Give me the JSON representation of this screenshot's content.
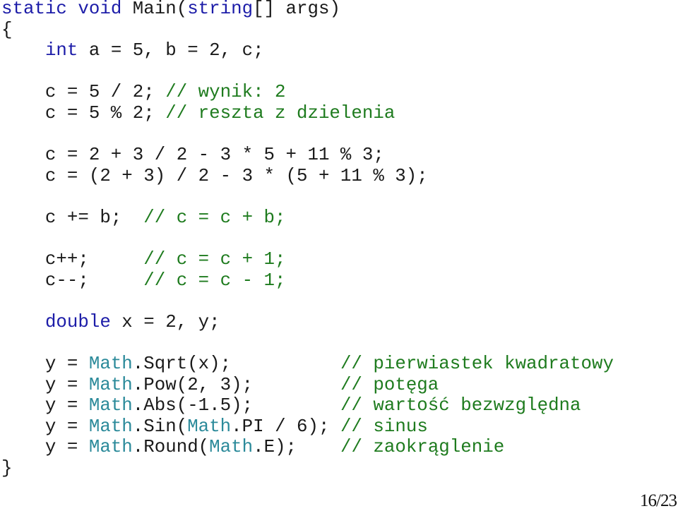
{
  "slide": {
    "page_indicator": "16/23",
    "colors": {
      "keyword": "#1c1ca8",
      "class": "#2b8a9a",
      "comment": "#1e7b1e",
      "text": "#1a1a1a"
    },
    "lines": [
      [
        [
          "kw",
          "static"
        ],
        [
          "t",
          " "
        ],
        [
          "kw",
          "void"
        ],
        [
          "t",
          " Main("
        ],
        [
          "kw",
          "string"
        ],
        [
          "t",
          "[] args)"
        ]
      ],
      [
        [
          "t",
          "{"
        ]
      ],
      [
        [
          "t",
          "    "
        ],
        [
          "kw",
          "int"
        ],
        [
          "t",
          " a = 5, b = 2, c;"
        ]
      ],
      [
        [
          "t",
          ""
        ]
      ],
      [
        [
          "t",
          "    c = 5 / 2; "
        ],
        [
          "cm",
          "// wynik: 2"
        ]
      ],
      [
        [
          "t",
          "    c = 5 % 2; "
        ],
        [
          "cm",
          "// reszta z dzielenia"
        ]
      ],
      [
        [
          "t",
          ""
        ]
      ],
      [
        [
          "t",
          "    c = 2 + 3 / 2 - 3 * 5 + 11 % 3;"
        ]
      ],
      [
        [
          "t",
          "    c = (2 + 3) / 2 - 3 * (5 + 11 % 3);"
        ]
      ],
      [
        [
          "t",
          ""
        ]
      ],
      [
        [
          "t",
          "    c += b;  "
        ],
        [
          "cm",
          "// c = c + b;"
        ]
      ],
      [
        [
          "t",
          ""
        ]
      ],
      [
        [
          "t",
          "    c++;     "
        ],
        [
          "cm",
          "// c = c + 1;"
        ]
      ],
      [
        [
          "t",
          "    c--;     "
        ],
        [
          "cm",
          "// c = c - 1;"
        ]
      ],
      [
        [
          "t",
          ""
        ]
      ],
      [
        [
          "t",
          "    "
        ],
        [
          "kw",
          "double"
        ],
        [
          "t",
          " x = 2, y;"
        ]
      ],
      [
        [
          "t",
          ""
        ]
      ],
      [
        [
          "t",
          "    y = "
        ],
        [
          "cls",
          "Math"
        ],
        [
          "t",
          ".Sqrt(x);          "
        ],
        [
          "cm",
          "// pierwiastek kwadratowy"
        ]
      ],
      [
        [
          "t",
          "    y = "
        ],
        [
          "cls",
          "Math"
        ],
        [
          "t",
          ".Pow(2, 3);        "
        ],
        [
          "cm",
          "// potęga"
        ]
      ],
      [
        [
          "t",
          "    y = "
        ],
        [
          "cls",
          "Math"
        ],
        [
          "t",
          ".Abs(-1.5);        "
        ],
        [
          "cm",
          "// wartość bezwzględna"
        ]
      ],
      [
        [
          "t",
          "    y = "
        ],
        [
          "cls",
          "Math"
        ],
        [
          "t",
          ".Sin("
        ],
        [
          "cls",
          "Math"
        ],
        [
          "t",
          ".PI / 6); "
        ],
        [
          "cm",
          "// sinus"
        ]
      ],
      [
        [
          "t",
          "    y = "
        ],
        [
          "cls",
          "Math"
        ],
        [
          "t",
          ".Round("
        ],
        [
          "cls",
          "Math"
        ],
        [
          "t",
          ".E);    "
        ],
        [
          "cm",
          "// zaokrąglenie"
        ]
      ],
      [
        [
          "t",
          "}"
        ]
      ]
    ]
  }
}
